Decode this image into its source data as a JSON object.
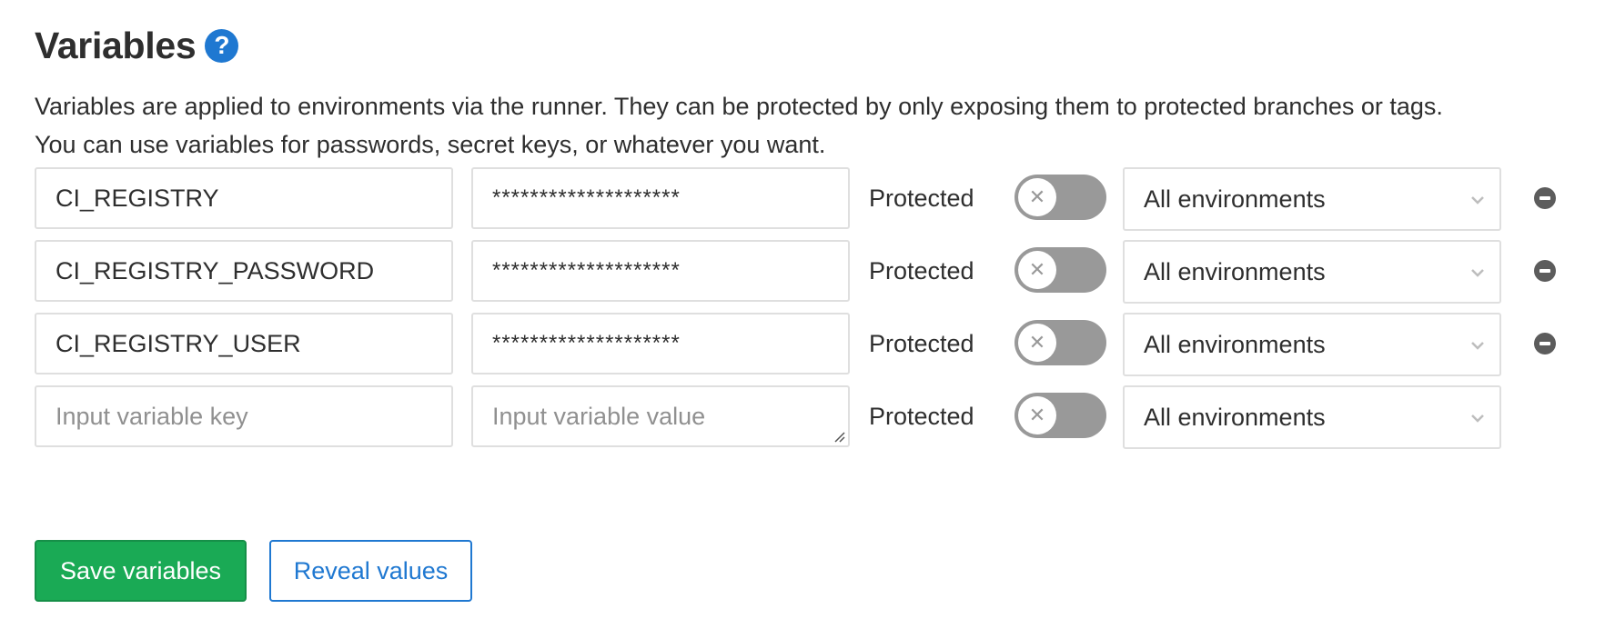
{
  "section": {
    "title": "Variables",
    "help_icon": "?",
    "description_line1": "Variables are applied to environments via the runner. They can be protected by only exposing them to protected branches or tags.",
    "description_line2": "You can use variables for passwords, secret keys, or whatever you want."
  },
  "variables": [
    {
      "key": "CI_REGISTRY",
      "value": "********************",
      "protected_label": "Protected",
      "protected": false,
      "environment": "All environments"
    },
    {
      "key": "CI_REGISTRY_PASSWORD",
      "value": "********************",
      "protected_label": "Protected",
      "protected": false,
      "environment": "All environments"
    },
    {
      "key": "CI_REGISTRY_USER",
      "value": "********************",
      "protected_label": "Protected",
      "protected": false,
      "environment": "All environments"
    }
  ],
  "new_variable": {
    "key_placeholder": "Input variable key",
    "value_placeholder": "Input variable value",
    "protected_label": "Protected",
    "protected": false,
    "environment": "All environments"
  },
  "actions": {
    "save_label": "Save variables",
    "reveal_label": "Reveal values"
  },
  "icons": {
    "help": "question-circle-icon",
    "toggle_off": "close-icon",
    "remove": "remove-circle-icon",
    "dropdown": "chevron-down-icon"
  },
  "colors": {
    "accent": "#1f78d1",
    "success": "#1aaa55",
    "toggle_off": "#999999",
    "border": "#dfdfdf",
    "text": "#2e2e2e"
  }
}
